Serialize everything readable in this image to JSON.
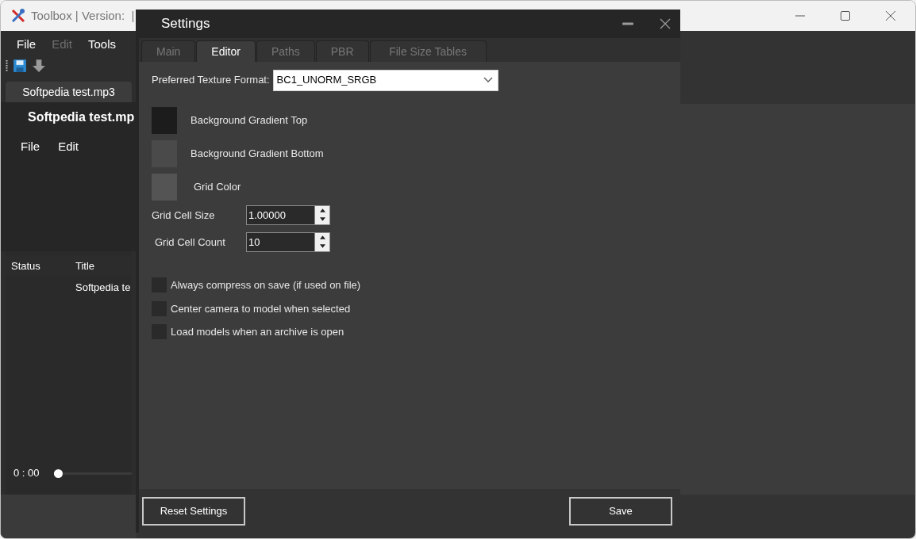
{
  "main_window": {
    "title": "Toolbox | Version:  |",
    "menu": [
      {
        "label": "File",
        "disabled": false
      },
      {
        "label": "Edit",
        "disabled": true
      },
      {
        "label": "Tools",
        "disabled": false
      }
    ],
    "file_tab": {
      "label": "Softpedia test.mp3"
    },
    "document_title": "Softpedia test.mp",
    "document_menu": [
      "File",
      "Edit"
    ],
    "table": {
      "columns": [
        "Status",
        "Title"
      ],
      "rows": [
        [
          "",
          "Softpedia te"
        ]
      ]
    },
    "player": {
      "time": "0 : 00",
      "level": 0.05
    }
  },
  "dialog": {
    "title": "Settings",
    "tabs": [
      {
        "label": "Main",
        "selected": false
      },
      {
        "label": "Editor",
        "selected": true
      },
      {
        "label": "Paths",
        "selected": false
      },
      {
        "label": "PBR",
        "selected": false
      },
      {
        "label": "File Size Tables",
        "selected": false
      }
    ],
    "texture_format": {
      "label": "Preferred Texture Format:",
      "value": "BC1_UNORM_SRGB"
    },
    "colors": [
      {
        "label": "Background Gradient Top",
        "color": "#1c1c1c"
      },
      {
        "label": "Background Gradient Bottom",
        "color": "#4a4a4a"
      },
      {
        "label": "Grid Color",
        "color": "#545454"
      }
    ],
    "spinners": [
      {
        "label": "Grid Cell Size",
        "value": "1.00000"
      },
      {
        "label": "Grid Cell Count",
        "value": "10"
      }
    ],
    "options": [
      {
        "label": "Always compress on save (if used on file)",
        "checked": false
      },
      {
        "label": "Center camera to model when selected",
        "checked": false
      },
      {
        "label": "Load models when an archive is open",
        "checked": false
      }
    ],
    "buttons": [
      "Reset Settings",
      "Save"
    ]
  }
}
